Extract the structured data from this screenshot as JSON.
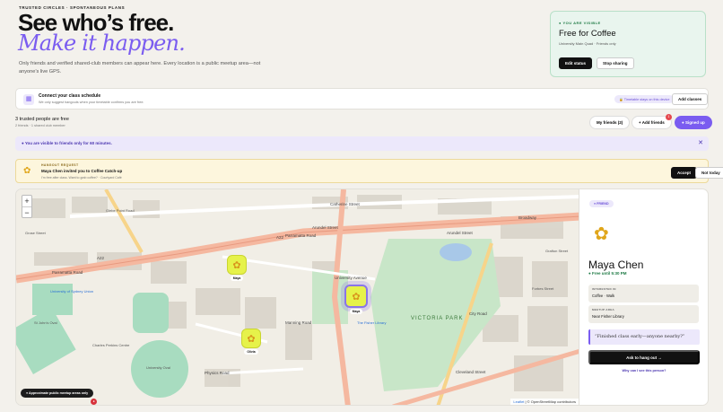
{
  "header": {
    "kicker": "TRUSTED CIRCLES · SPONTANEOUS PLANS",
    "headline": "See who’s free.",
    "headline_accent": "Make it happen.",
    "intro": "Only friends and verified shared-club members can appear here. Every location is a public meetup area—not anyone’s live GPS."
  },
  "visibility_card": {
    "kicker": "● YOU ARE VISIBLE",
    "title": "Free for Coffee",
    "subtitle": "University Main Quad · Friends only",
    "edit_label": "Edit status",
    "stop_label": "Stop sharing"
  },
  "schedule": {
    "title": "Connect your class schedule",
    "subtitle": "We only suggest hangouts when your timetable confirms you are free.",
    "pill": "🔒 Timetable stays on this device",
    "button": "Add classes"
  },
  "trusted": {
    "title": "3 trusted people are free",
    "subtitle": "2 friends · 1 shared club member",
    "my_friends": "My friends (2)",
    "add_friends": "+ Add friends",
    "add_friends_badge": "1",
    "signed_up": "● Signed up"
  },
  "visibility_banner": {
    "text": "● You are visible to friends only for 60 minutes.",
    "close": "✕"
  },
  "hangout_request": {
    "kicker": "HANGOUT REQUEST",
    "title": "Maya Chen invited you to Coffee Catch-up",
    "subtitle": "I’m free after class. Want to grab coffee? · Courtyard Café",
    "accept": "Accept",
    "decline": "Not today"
  },
  "map": {
    "zoom_in": "+",
    "zoom_out": "−",
    "approx_label": "● Approximate public meetup areas only",
    "corner_badge": "●",
    "attribution_leaflet": "Leaflet",
    "attribution_rest": " | © OpenStreetMap contributors",
    "markers": [
      {
        "name": "Maya",
        "avatar": "✿"
      },
      {
        "name": "Maya",
        "avatar": "✿"
      },
      {
        "name": "Olivia",
        "avatar": "✿"
      }
    ],
    "labels": {
      "catherine": "Catherine Street",
      "arundel_w": "Arundel Street",
      "arundel_e": "Arundel Street",
      "broadway": "Broadway",
      "parramatta_w": "Parramatta Road",
      "parramatta_e": "Parramatta Road",
      "a22_w": "A22",
      "a22_e": "A22",
      "university_ave": "University Avenue",
      "victoria_park": "VICTORIA PARK",
      "city_road": "City Road",
      "cleveland": "Cleveland Street",
      "manning": "Manning Road",
      "physics": "Physics Road",
      "university_oval": "University Oval",
      "charles_perkins": "Charles Perkins Centre",
      "st_johns": "St John's Oval",
      "grose": "Grose Street",
      "glebe": "Glebe Point Road",
      "usyd_union": "University of Sydney Union",
      "tm_library": "The Fisher Library",
      "grafton": "Grafton Street",
      "forbes": "Forbes Street"
    }
  },
  "profile": {
    "pill": "● FRIEND",
    "avatar": "✿",
    "name": "Maya Chen",
    "free_until": "● Free until 5:30 PM",
    "interested_label": "INTERESTED IN",
    "interested_value": "Coffee · Walk",
    "meetup_label": "MEETUP AREA",
    "meetup_value": "Near Fisher Library",
    "quote": "“Finished class early—anyone nearby?”",
    "ask_label": "Ask to hang out →",
    "why_label": "Why can I see this person?"
  }
}
